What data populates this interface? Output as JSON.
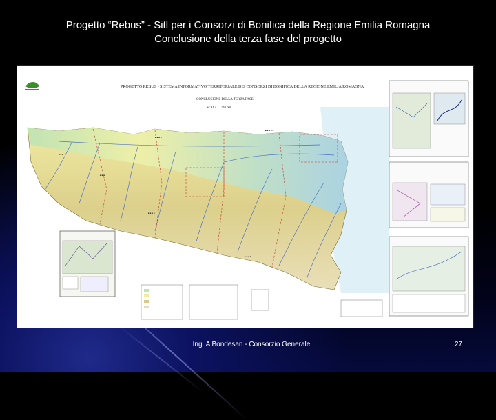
{
  "slide": {
    "title_line1": "Progetto “Rebus” - Sitl per i Consorzi di Bonifica della Regione Emilia Romagna",
    "title_line2": "Conclusione della terza fase del progetto",
    "footer": "Ing. A Bondesan - Consorzio Generale",
    "page_number": "27"
  },
  "poster": {
    "heading": "PROGETTO REBUS - SISTEMA INFORMATIVO TERRITORIALE DEI CONSORZI DI BONIFICA DELLA REGIONE EMILIA ROMAGNA",
    "subheading": "CONCLUSIONE DELLA TERZA FASE",
    "scale": "SCALA 1 : 250.000",
    "colors": {
      "sea": "#dff1f7",
      "plain_green": "#bfe3b5",
      "plain_yellow": "#f1ec9e",
      "hills": "#d9c98a",
      "mountains": "#e6ddb4",
      "rivers": "#2f58c9",
      "boundary": "#c0392b"
    }
  }
}
